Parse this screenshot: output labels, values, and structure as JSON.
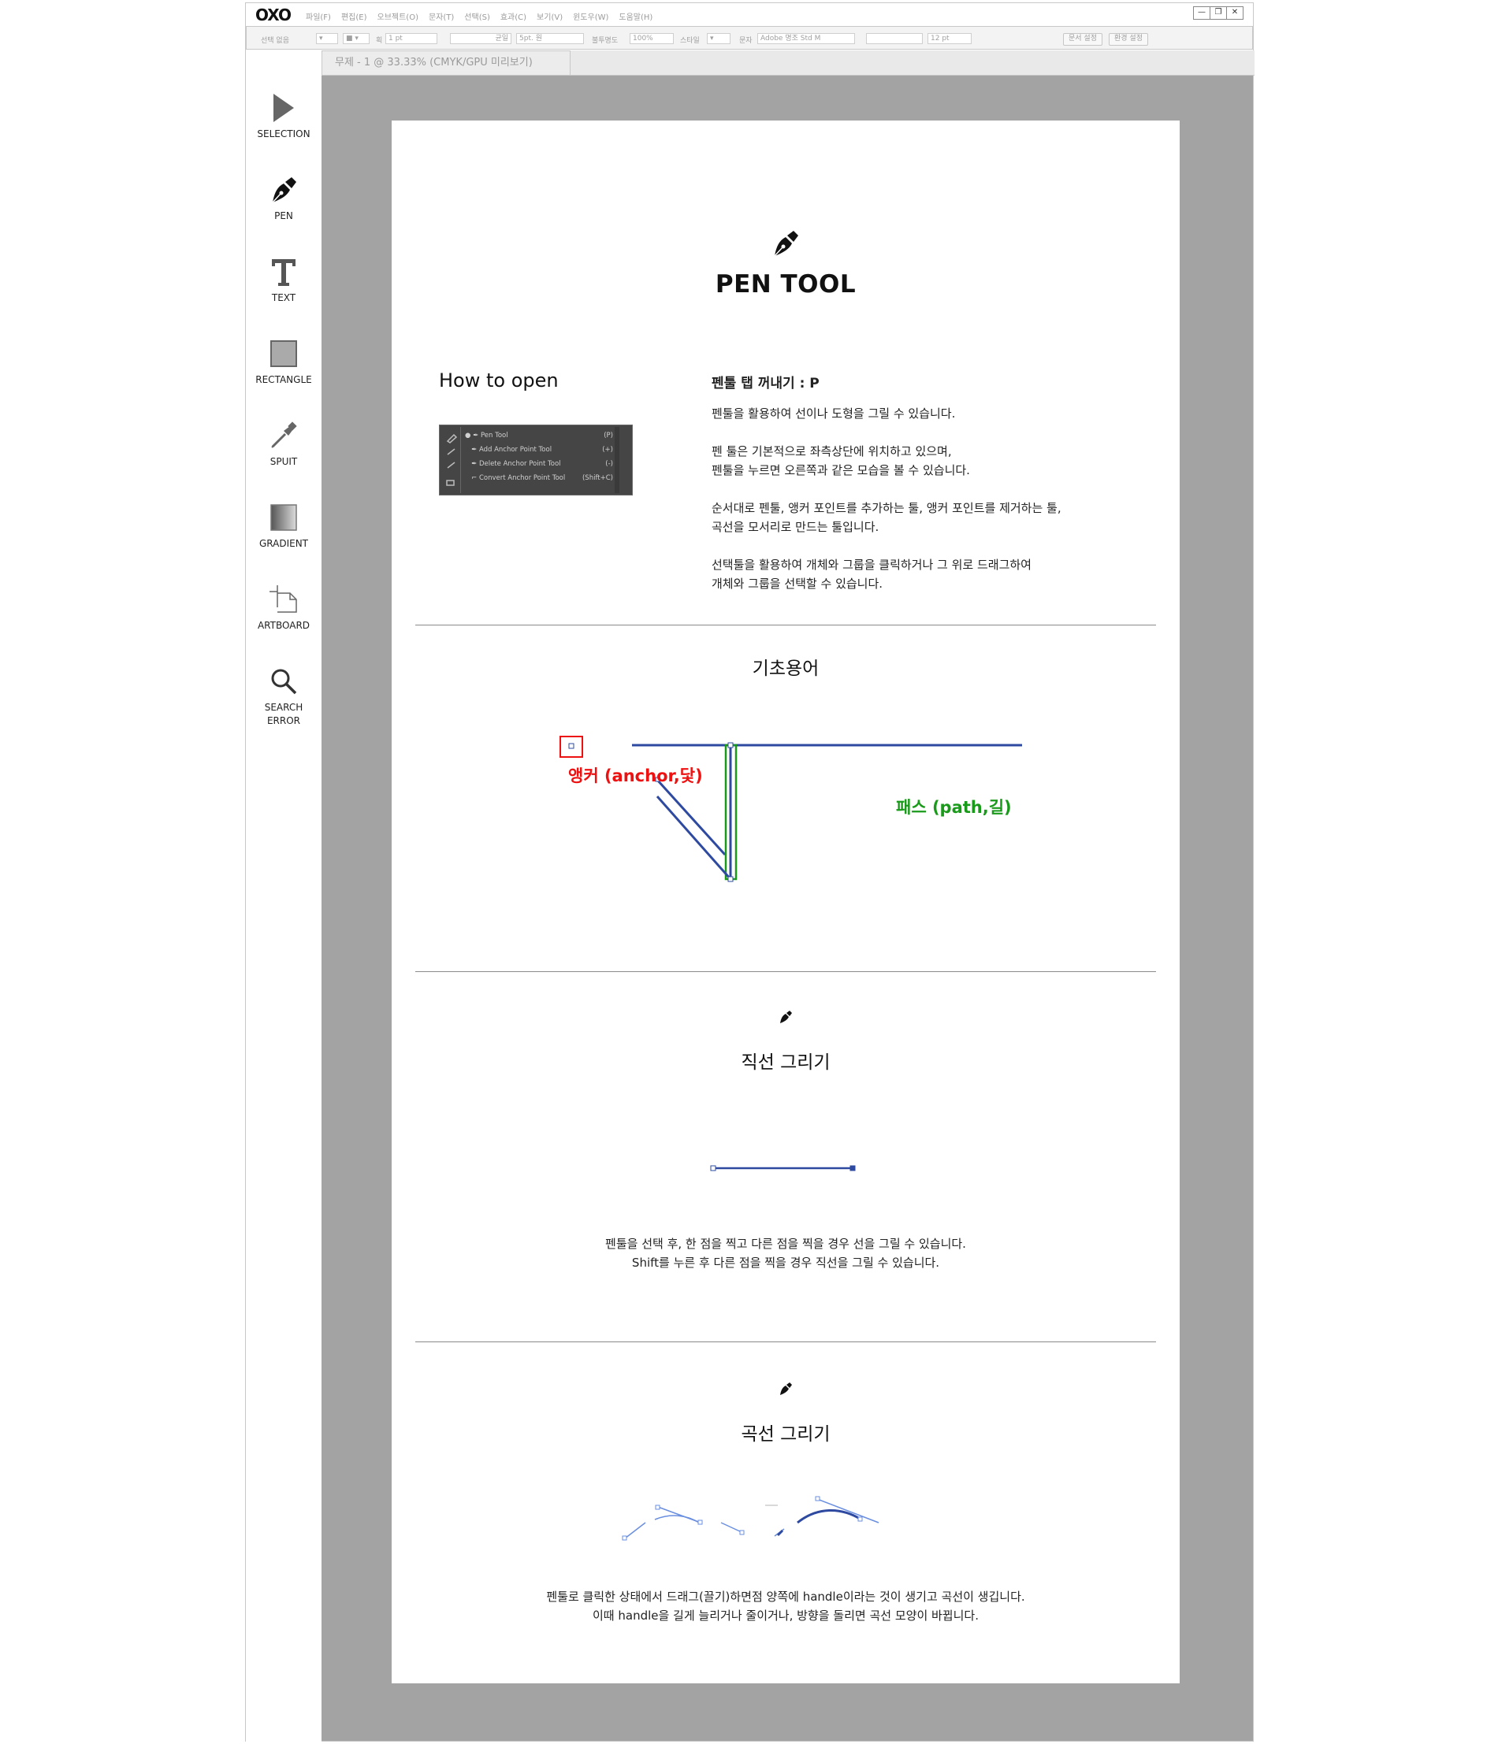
{
  "app": {
    "logo": "OXO",
    "menus": [
      "파일(F)",
      "편집(E)",
      "오브젝트(O)",
      "문자(T)",
      "선택(S)",
      "효과(C)",
      "보기(V)",
      "윈도우(W)",
      "도움말(H)"
    ],
    "window_controls": [
      "—",
      "❐",
      "✕"
    ]
  },
  "control_bar": {
    "selection_label": "선택 없음",
    "stroke_label": "획",
    "stroke_value": "1 pt",
    "stroke_style": "균일",
    "brush_value": "5pt. 원",
    "opacity_label": "불투명도",
    "opacity_value": "100%",
    "style_label": "스타일",
    "font_label": "문자",
    "font_value": "Adobe 명조 Std M",
    "size_value": "12 pt",
    "doc_setup_button": "문서 설정",
    "prefs_button": "환경 설정"
  },
  "tab": {
    "label": "무제 - 1 @ 33.33% (CMYK/GPU 미리보기)"
  },
  "tools": [
    {
      "name": "selection-tool",
      "icon": "arrow-cursor-icon",
      "label": "SELECTION"
    },
    {
      "name": "pen-tool",
      "icon": "pen-nib-icon",
      "label": "PEN"
    },
    {
      "name": "text-tool",
      "icon": "type-t-icon",
      "label": "TEXT"
    },
    {
      "name": "rectangle-tool",
      "icon": "square-icon",
      "label": "RECTANGLE"
    },
    {
      "name": "spuit-tool",
      "icon": "eyedropper-icon",
      "label": "SPUIT"
    },
    {
      "name": "gradient-tool",
      "icon": "gradient-square-icon",
      "label": "GRADIENT"
    },
    {
      "name": "artboard-tool",
      "icon": "artboard-icon",
      "label": "ARTBOARD"
    },
    {
      "name": "search-error-tool",
      "icon": "magnifier-icon",
      "label": "SEARCH\nERROR"
    }
  ],
  "doc": {
    "title": "PEN TOOL",
    "how_to_open": "How to open",
    "menu_items": [
      {
        "label": "Pen Tool",
        "key": "(P)"
      },
      {
        "label": "Add Anchor Point Tool",
        "key": "(+)"
      },
      {
        "label": "Delete Anchor Point Tool",
        "key": "(-)"
      },
      {
        "label": "Convert Anchor Point Tool",
        "key": "(Shift+C)"
      }
    ],
    "shortcut_heading": "펜툴 탭 꺼내기 : P",
    "para1": "펜툴을 활용하여 선이나 도형을 그릴 수 있습니다.",
    "para2a": "펜 툴은 기본적으로 좌측상단에 위치하고 있으며,",
    "para2b": "펜툴을 누르면 오른쪽과 같은 모습을 볼 수 있습니다.",
    "para3a": "순서대로 펜툴, 앵커 포인트를 추가하는 툴, 앵커 포인트를 제거하는 툴,",
    "para3b": "곡선을 모서리로 만드는 툴입니다.",
    "para4a": "선택툴을 활용하여 개체와 그룹을 클릭하거나 그 위로 드래그하여",
    "para4b": "개체와 그룹을 선택할 수 있습니다.",
    "basics_heading": "기초용어",
    "anchor_label": "앵커 (anchor,닻)",
    "path_label": "패스 (path,길)",
    "straight_heading": "직선 그리기",
    "straight_p1": "펜툴을 선택 후, 한 점을 찍고 다른 점을 찍을 경우 선을 그릴 수 있습니다.",
    "straight_p2": "Shift를 누른 후 다른 점을 찍을 경우 직선을 그릴 수 있습니다.",
    "curve_heading": "곡선 그리기",
    "curve_p1": "펜툴로 클릭한 상태에서 드래그(끌기)하면점 양쪽에 handle이라는 것이 생기고 곡선이 생깁니다.",
    "curve_p2": "이때 handle을 길게 늘리거나 줄이거나, 방향을 돌리면 곡선 모양이 바뀝니다."
  },
  "colors": {
    "canvas_bg": "#a3a3a3",
    "path_blue": "#2e4aa0",
    "anchor_red": "#ee1111",
    "path_green": "#1a9a1a"
  }
}
